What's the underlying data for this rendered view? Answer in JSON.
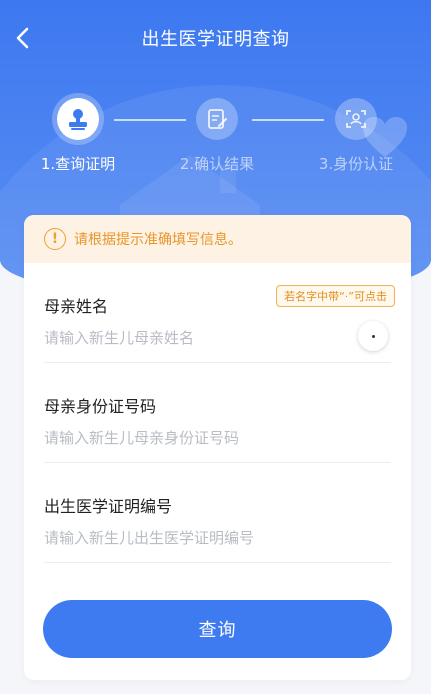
{
  "header": {
    "title": "出生医学证明查询"
  },
  "steps": [
    {
      "label": "1.查询证明",
      "state": "active",
      "icon": "stamp-icon"
    },
    {
      "label": "2.确认结果",
      "state": "inactive",
      "icon": "edit-document-icon"
    },
    {
      "label": "3.身份认证",
      "state": "inactive",
      "icon": "face-scan-icon"
    }
  ],
  "notice": {
    "icon": "exclamation-icon",
    "text": "请根据提示准确填写信息。"
  },
  "form": {
    "mother_name": {
      "label": "母亲姓名",
      "placeholder": "请输入新生儿母亲姓名",
      "tip": "若名字中带“·”可点击"
    },
    "mother_id": {
      "label": "母亲身份证号码",
      "placeholder": "请输入新生儿母亲身份证号码"
    },
    "cert_no": {
      "label": "出生医学证明编号",
      "placeholder": "请输入新生儿出生医学证明编号"
    }
  },
  "submit_label": "查询",
  "colors": {
    "primary": "#3f7bf0",
    "warning": "#f0a030",
    "notice_bg": "#fdf2e4"
  }
}
